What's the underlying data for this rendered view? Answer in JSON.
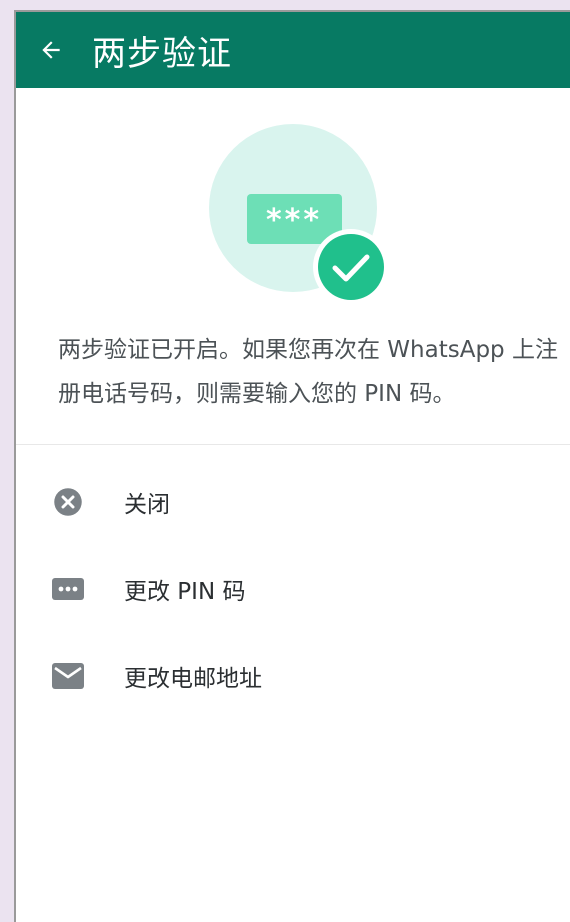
{
  "header": {
    "title": "两步验证"
  },
  "description": "两步验证已开启。如果您再次在 WhatsApp 上注册电话号码，则需要输入您的 PIN 码。",
  "illustration": {
    "pin_mask": "***"
  },
  "options": [
    {
      "label": "关闭",
      "icon": "close-circle-icon"
    },
    {
      "label": "更改 PIN 码",
      "icon": "pin-dots-icon"
    },
    {
      "label": "更改电邮地址",
      "icon": "email-icon"
    }
  ],
  "colors": {
    "appbar": "#077a63",
    "accent": "#20c08c",
    "illustration_bg": "#d9f4ee",
    "pin_box": "#6ddfb6",
    "icon_gray": "#7b8186"
  }
}
